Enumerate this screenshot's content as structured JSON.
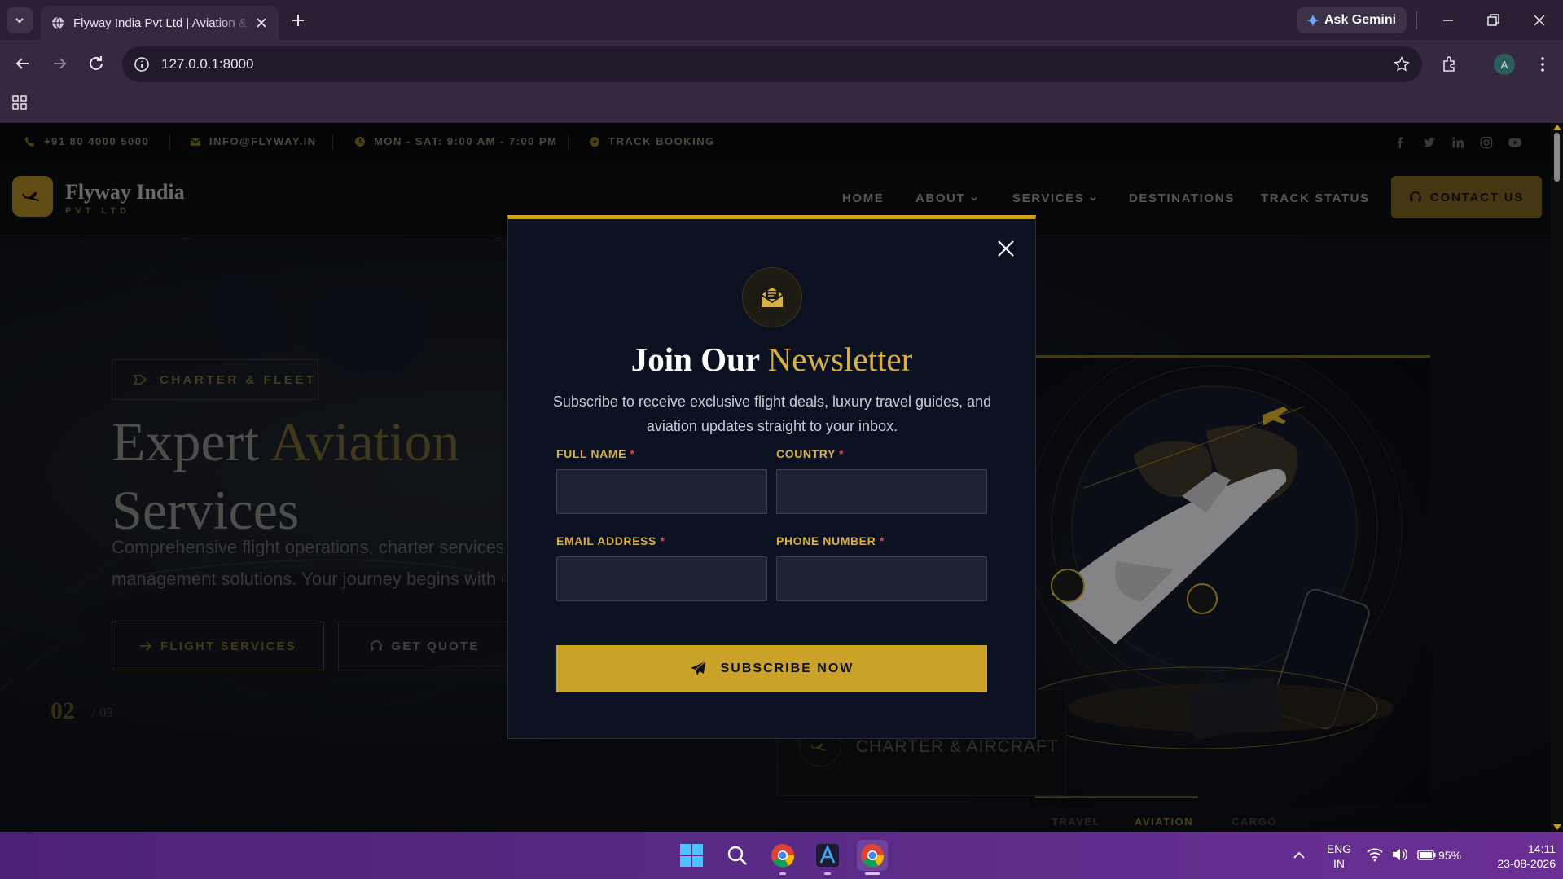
{
  "browser": {
    "tab_title": "Flyway India Pvt Ltd | Aviation & Travel",
    "ask_gemini": "Ask Gemini",
    "url": "127.0.0.1:8000",
    "profile_initial": "A"
  },
  "topbar": {
    "phone": "+91 80 4000 5000",
    "email": "INFO@FLYWAY.IN",
    "hours": "MON - SAT: 9:00 AM - 7:00 PM",
    "track": "TRACK BOOKING",
    "socials": [
      "facebook-icon",
      "twitter-icon",
      "linkedin-icon",
      "instagram-icon",
      "youtube-icon"
    ]
  },
  "header": {
    "logo_name": "Flyway India",
    "logo_sub": "PVT LTD",
    "nav": {
      "home": "HOME",
      "about": "ABOUT",
      "services": "SERVICES",
      "destinations": "DESTINATIONS",
      "track_status": "TRACK STATUS"
    },
    "contact": "CONTACT US"
  },
  "hero": {
    "pill": "CHARTER & FLEET",
    "title_a": "Expert ",
    "title_gold": "Aviation",
    "title_b": "Services",
    "desc_1": "Comprehensive flight operations, charter services,",
    "desc_2": "management solutions. Your journey begins with o",
    "btn_primary": "FLIGHT SERVICES",
    "btn_secondary": "GET QUOTE",
    "slide_current": "02",
    "slide_total": "/ 03",
    "card_label": "CHARTER & AIRCRAFT",
    "image_tabs": {
      "travel": "TRAVEL",
      "aviation": "AVIATION",
      "cargo": "CARGO"
    }
  },
  "modal": {
    "title_a": "Join Our ",
    "title_gold": "Newsletter",
    "description": "Subscribe to receive exclusive flight deals, luxury travel guides, and aviation updates straight to your inbox.",
    "fields": {
      "full_name": "FULL NAME",
      "country": "COUNTRY",
      "email": "EMAIL ADDRESS",
      "phone": "PHONE NUMBER",
      "required_mark": "*"
    },
    "submit": "SUBSCRIBE NOW"
  },
  "taskbar": {
    "lang_1": "ENG",
    "lang_2": "IN",
    "battery": "95%",
    "time": "14:11",
    "date": "23-08-2026"
  },
  "colors": {
    "gold": "#c9a227",
    "modal_bg": "#0b1120",
    "required": "#e2474a",
    "taskbar": "#5a2a88"
  }
}
